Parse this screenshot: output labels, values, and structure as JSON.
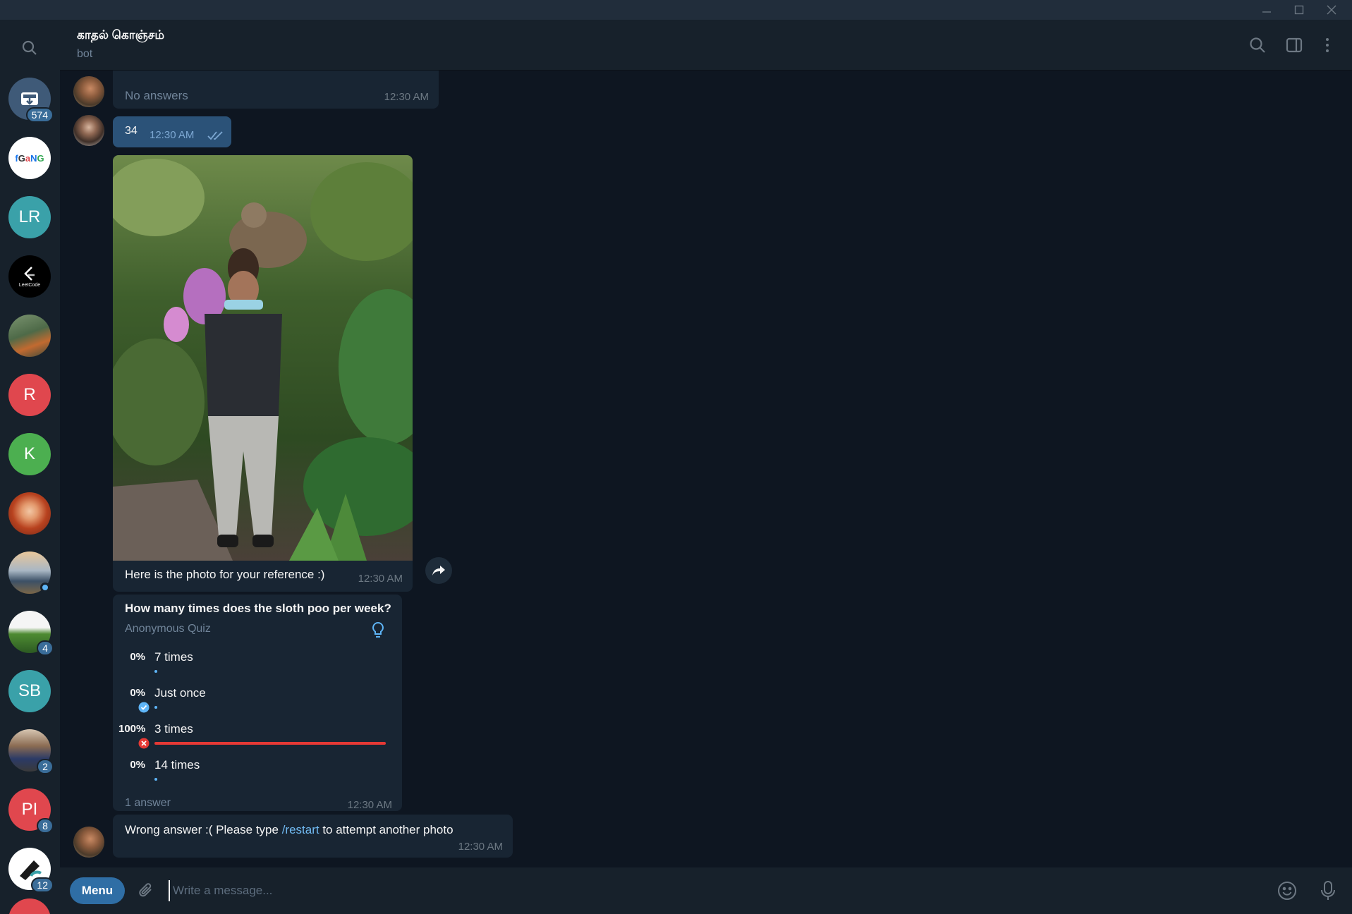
{
  "header": {
    "title": "காதல் கொஞ்சம்",
    "subtitle": "bot"
  },
  "sidebar": {
    "chats": [
      {
        "name": "saved",
        "initials": "",
        "badge": "574",
        "color": "#3f5a78"
      },
      {
        "name": "gang",
        "initials": "",
        "badge": "",
        "color": "#ffffff"
      },
      {
        "name": "lr",
        "initials": "LR",
        "badge": "",
        "color": "#3aa1a9"
      },
      {
        "name": "leetcode",
        "initials": "",
        "badge": "",
        "color": "#000000"
      },
      {
        "name": "birds",
        "initials": "",
        "badge": "",
        "color": "#5a7a5a"
      },
      {
        "name": "r",
        "initials": "R",
        "badge": "",
        "color": "#e0474e"
      },
      {
        "name": "k",
        "initials": "K",
        "badge": "",
        "color": "#4caf50"
      },
      {
        "name": "girl",
        "initials": "",
        "badge": "",
        "color": "#c0542e"
      },
      {
        "name": "lake",
        "initials": "",
        "badge": "",
        "color": "#6f8eab"
      },
      {
        "name": "field",
        "initials": "",
        "badge": "4",
        "color": "#4a8c3a"
      },
      {
        "name": "sb",
        "initials": "SB",
        "badge": "",
        "color": "#3aa1a9"
      },
      {
        "name": "group",
        "initials": "",
        "badge": "2",
        "color": "#6a5848"
      },
      {
        "name": "pi",
        "initials": "PI",
        "badge": "8",
        "color": "#e0474e"
      },
      {
        "name": "tech",
        "initials": "",
        "badge": "12",
        "color": "#ffffff"
      },
      {
        "name": "red",
        "initials": "",
        "badge": "",
        "color": "#e0474e"
      }
    ]
  },
  "messages": {
    "m1": {
      "text": "No answers",
      "time": "12:30 AM"
    },
    "m2": {
      "text": "34",
      "time": "12:30 AM"
    },
    "m3": {
      "caption": "Here is the photo for your reference :)",
      "time": "12:30 AM"
    },
    "poll": {
      "question": "How many times does the sloth poo per week?",
      "type": "Anonymous Quiz",
      "options": [
        {
          "pct": "0%",
          "label": "7 times"
        },
        {
          "pct": "0%",
          "label": "Just once"
        },
        {
          "pct": "100%",
          "label": "3 times"
        },
        {
          "pct": "0%",
          "label": "14 times"
        }
      ],
      "answers": "1 answer",
      "time": "12:30 AM"
    },
    "m4": {
      "text_before": "Wrong answer :( Please type ",
      "command": "/restart",
      "text_after": " to attempt another photo",
      "time": "12:30 AM"
    }
  },
  "composer": {
    "menu_label": "Menu",
    "placeholder": "Write a message..."
  }
}
